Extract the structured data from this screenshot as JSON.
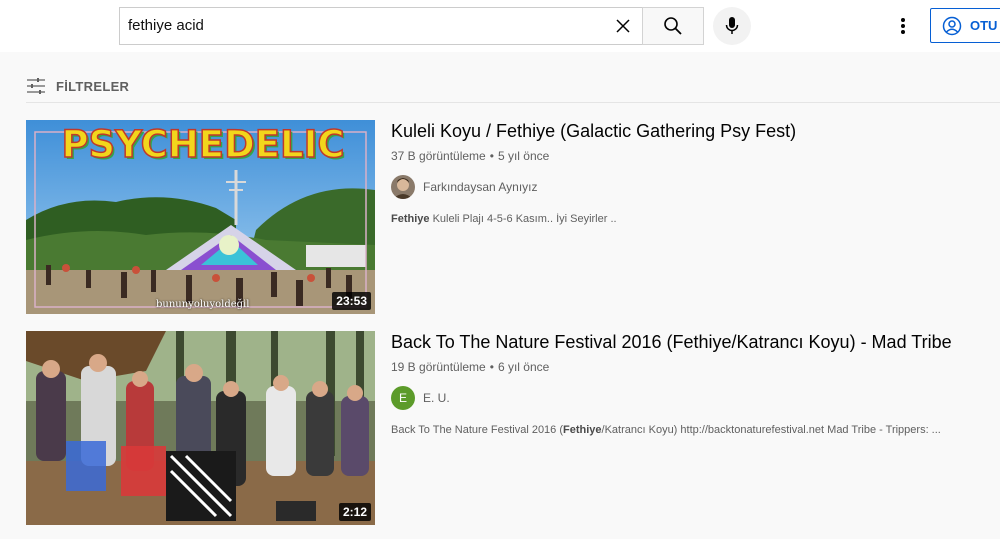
{
  "search": {
    "query": "fethiye acid",
    "clear_icon": "close-icon",
    "search_icon": "search-icon",
    "mic_icon": "microphone-icon"
  },
  "header": {
    "more_icon": "more-vert-icon",
    "signin_label": "OTU",
    "signin_icon": "account-circle-icon"
  },
  "filters": {
    "label": "FİLTRELER",
    "icon": "tune-icon"
  },
  "results": [
    {
      "title": "Kuleli Koyu / Fethiye (Galactic Gathering Psy Fest)",
      "views": "37 B görüntüleme",
      "age": "5 yıl önce",
      "channel": "Farkındaysan Aynıyız",
      "desc_bold": "Fethiye",
      "desc_rest": " Kuleli Plajı 4-5-6 Kasım.. İyi Seyirler ..",
      "duration": "23:53",
      "thumb_title": "PSYCHEDELIC",
      "thumb_watermark": "bununyoluyoldeğil"
    },
    {
      "title": "Back To The Nature Festival 2016 (Fethiye/Katrancı Koyu) - Mad Tribe",
      "views": "19 B görüntüleme",
      "age": "6 yıl önce",
      "channel": "E. U.",
      "avatar_letter": "E",
      "avatar_color": "#5c9b2a",
      "desc_pre": "Back To The Nature Festival 2016 (",
      "desc_bold": "Fethiye",
      "desc_rest": "/Katrancı Koyu) http://backtonaturefestival.net Mad Tribe - Trippers: ...",
      "duration": "2:12"
    }
  ],
  "separator": "•",
  "colors": {
    "accent": "#065fd4",
    "meta_text": "#606060"
  }
}
